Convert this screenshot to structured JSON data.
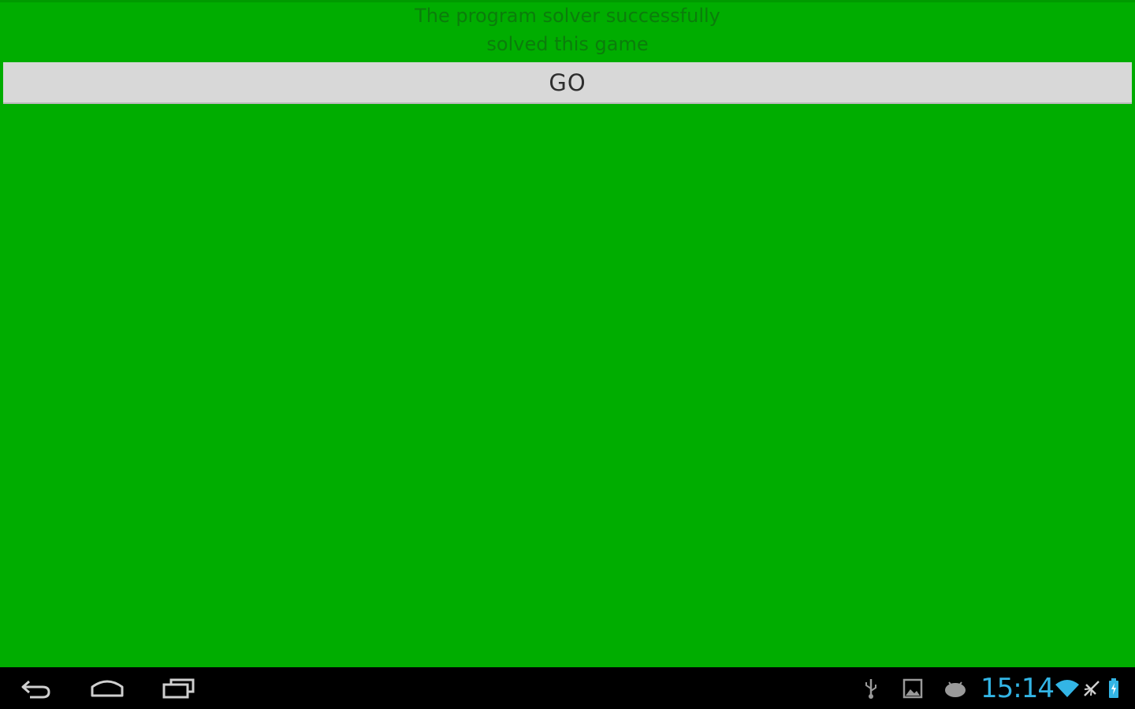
{
  "app": {
    "message_line1": "The program solver successfully",
    "message_line2": "solved this game",
    "go_label": "GO",
    "background_color": "#00ad00"
  },
  "system_bar": {
    "clock": "15:14",
    "nav_icons": [
      "back-icon",
      "home-icon",
      "recent-apps-icon"
    ],
    "status_icons": [
      "usb-icon",
      "gallery-notification-icon",
      "android-debug-icon",
      "wifi-icon",
      "airplane-mode-icon",
      "battery-icon"
    ],
    "accent_color": "#33b5e5"
  }
}
